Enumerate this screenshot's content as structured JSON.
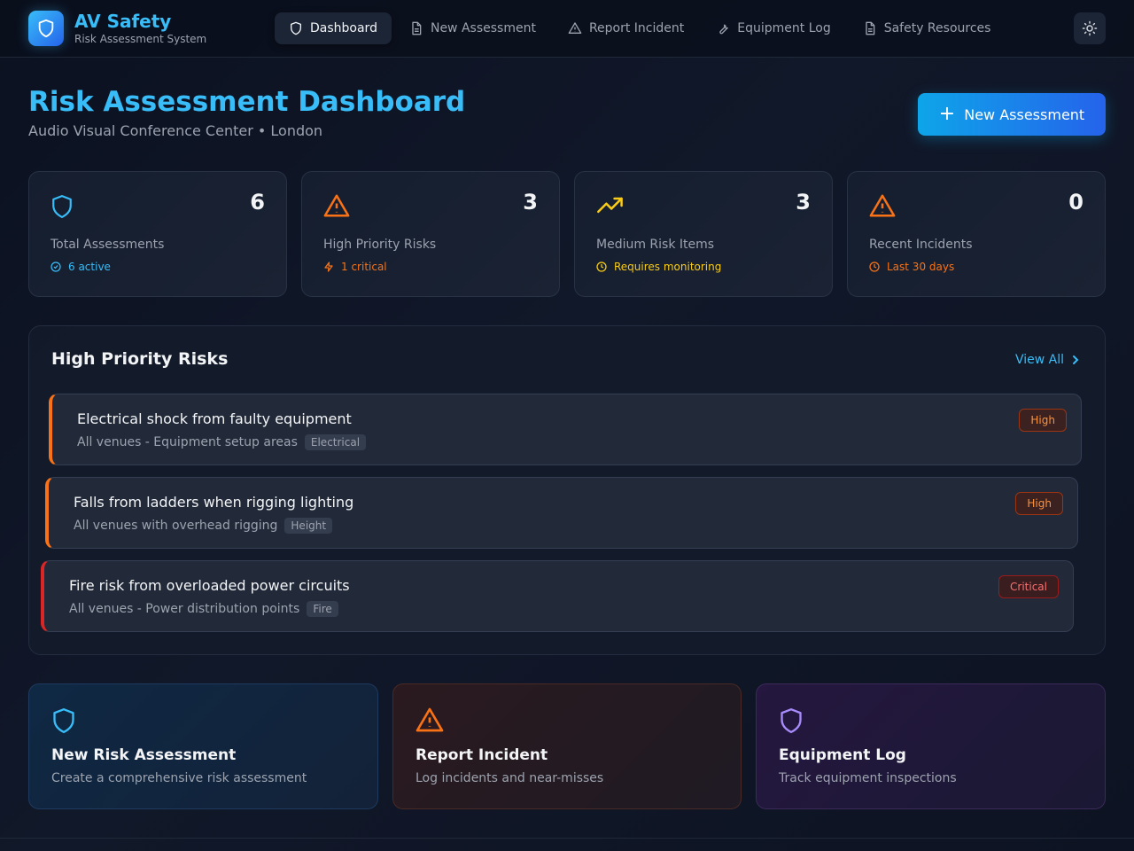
{
  "brand": {
    "title": "AV Safety",
    "subtitle": "Risk Assessment System",
    "icon": "shield-icon"
  },
  "nav": [
    {
      "label": "Dashboard",
      "icon": "shield-icon",
      "active": true
    },
    {
      "label": "New Assessment",
      "icon": "document-icon"
    },
    {
      "label": "Report Incident",
      "icon": "warning-icon"
    },
    {
      "label": "Equipment Log",
      "icon": "wrench-icon"
    },
    {
      "label": "Safety Resources",
      "icon": "document-icon"
    }
  ],
  "theme_toggle": {
    "icon": "sun-icon"
  },
  "page": {
    "title": "Risk Assessment Dashboard",
    "subtitle": "Audio Visual Conference Center • London",
    "primary_action": "New Assessment"
  },
  "stats": [
    {
      "value": "6",
      "label": "Total Assessments",
      "note": "6 active",
      "icon": "shield-icon",
      "note_icon": "check-circle-icon",
      "color": "#38bdf8"
    },
    {
      "value": "3",
      "label": "High Priority Risks",
      "note": "1 critical",
      "icon": "warning-icon",
      "note_icon": "lightning-icon",
      "color": "#f97316"
    },
    {
      "value": "3",
      "label": "Medium Risk Items",
      "note": "Requires monitoring",
      "icon": "trending-up-icon",
      "note_icon": "clock-icon",
      "color": "#facc15"
    },
    {
      "value": "0",
      "label": "Recent Incidents",
      "note": "Last 30 days",
      "icon": "warning-icon",
      "note_icon": "clock-icon",
      "color": "#f97316"
    }
  ],
  "risks_panel": {
    "title": "High Priority Risks",
    "view_all": "View All",
    "items": [
      {
        "title": "Electrical shock from faulty equipment",
        "location": "All venues - Equipment setup areas",
        "category": "Electrical",
        "level": "High"
      },
      {
        "title": "Falls from ladders when rigging lighting",
        "location": "All venues with overhead rigging",
        "category": "Height",
        "level": "High"
      },
      {
        "title": "Fire risk from overloaded power circuits",
        "location": "All venues - Power distribution points",
        "category": "Fire",
        "level": "Critical"
      }
    ]
  },
  "quick_actions": [
    {
      "title": "New Risk Assessment",
      "subtitle": "Create a comprehensive risk assessment",
      "icon": "shield-icon",
      "color": "#38bdf8"
    },
    {
      "title": "Report Incident",
      "subtitle": "Log incidents and near-misses",
      "icon": "warning-icon",
      "color": "#f97316"
    },
    {
      "title": "Equipment Log",
      "subtitle": "Track equipment inspections",
      "icon": "shield-icon",
      "color": "#a78bfa"
    }
  ]
}
